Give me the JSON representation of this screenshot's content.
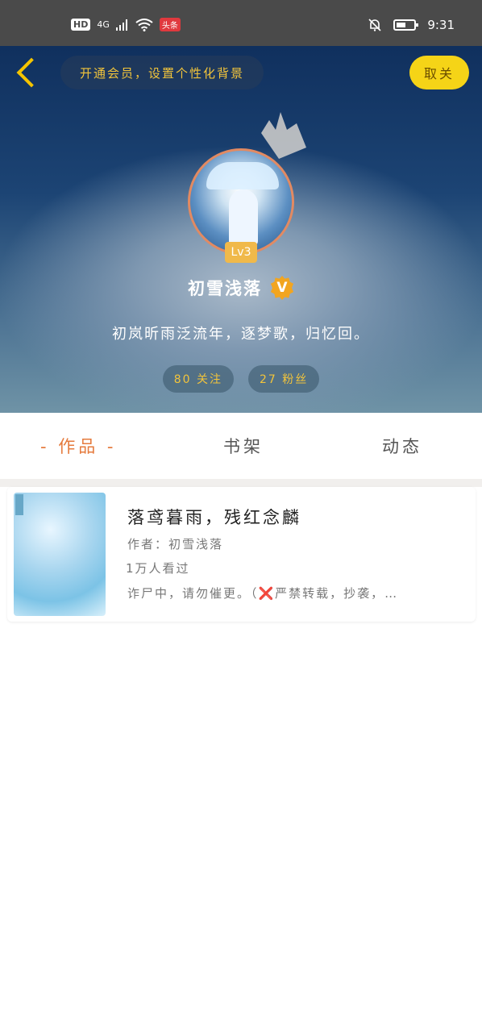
{
  "status_bar": {
    "hd": "HD",
    "network": "4G",
    "app_badge": "头条",
    "time": "9:31",
    "battery_level": 0.55
  },
  "header": {
    "vip_banner": "开通会员，设置个性化背景",
    "unfollow_label": "取关",
    "level": "Lv3",
    "username": "初雪浅落",
    "verified_mark": "V",
    "bio": "初岚昕雨泛流年，逐梦歌，归忆回。",
    "following": "80 关注",
    "fans": "27 粉丝"
  },
  "tabs": [
    {
      "label": "- 作品 -",
      "active": true
    },
    {
      "label": "书架",
      "active": false
    },
    {
      "label": "动态",
      "active": false
    }
  ],
  "books": [
    {
      "title": "落鸢暮雨，残红念麟",
      "author": "作者：初雪浅落",
      "views": "1万人看过",
      "description": "诈尸中，请勿催更。（❌严禁转载，抄袭，…"
    }
  ],
  "colors": {
    "accent_yellow": "#f5d417",
    "tab_active": "#e57a3c",
    "pill_text": "#f2c43b"
  }
}
